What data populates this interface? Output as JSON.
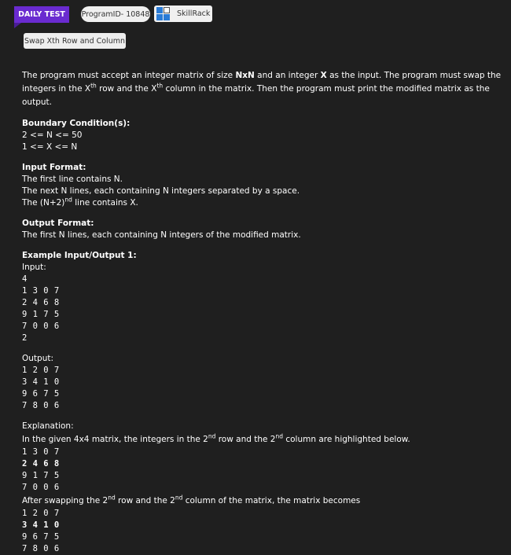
{
  "header": {
    "daily_test": "DAILY TEST",
    "program_id": "ProgramID- 10848",
    "skillrack": "SkillRack"
  },
  "problem_title": "Swap Xth Row and Column",
  "description": {
    "p1a": "The program must accept an integer matrix of size ",
    "p1b": "NxN",
    "p1c": " and an integer ",
    "p1d": "X",
    "p1e": " as the input. The program must swap the integers in the X",
    "p1f": "th",
    "p1g": " row and the X",
    "p1h": "th",
    "p1i": " column in the matrix. Then the program must print the modified matrix as the output."
  },
  "boundary": {
    "heading": "Boundary Condition(s):",
    "lines": [
      "2 <= N <= 50",
      "1 <= X <= N"
    ]
  },
  "input_format": {
    "heading": "Input Format:",
    "l1": "The first line contains N.",
    "l2": "The next N lines, each containing N integers separated by a space.",
    "l3a": "The (N+2)",
    "l3b": "nd",
    "l3c": " line contains X."
  },
  "output_format": {
    "heading": "Output Format:",
    "l1": "The first N lines, each containing N integers of the modified matrix."
  },
  "example": {
    "heading": "Example Input/Output 1:",
    "input_label": "Input:",
    "input_lines": [
      "4",
      "1 3 0 7",
      "2 4 6 8",
      "9 1 7 5",
      "7 0 0 6",
      "2"
    ],
    "output_label": "Output:",
    "output_lines": [
      "1 2 0 7",
      "3 4 1 0",
      "9 6 7 5",
      "7 8 0 6"
    ],
    "explanation_label": "Explanation:",
    "exp1a": "In the given 4x4 matrix, the integers in the 2",
    "exp1b": "nd",
    "exp1c": " row and the 2",
    "exp1d": "nd",
    "exp1e": " column are highlighted below.",
    "given_lines": [
      "1 3 0 7",
      "2 4 6 8",
      "9 1 7 5",
      "7 0 0 6"
    ],
    "exp2a": "After swapping the 2",
    "exp2b": "nd",
    "exp2c": " row and the 2",
    "exp2d": "nd",
    "exp2e": " column of the matrix, the matrix becomes",
    "result_lines": [
      "1 2 0 7",
      "3 4 1 0",
      "9 6 7 5",
      "7 8 0 6"
    ]
  },
  "colors": {
    "background": "#1f1f1f",
    "accent": "#6a2bd0"
  }
}
